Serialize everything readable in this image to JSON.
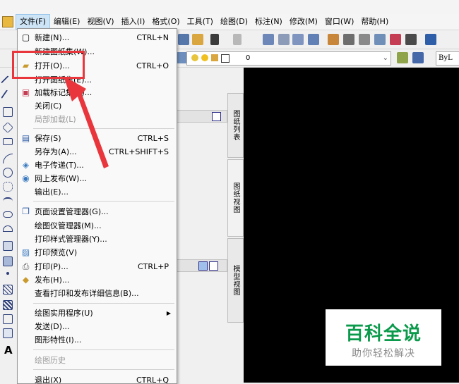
{
  "menubar": {
    "items": [
      "文件(F)",
      "编辑(E)",
      "视图(V)",
      "插入(I)",
      "格式(O)",
      "工具(T)",
      "绘图(D)",
      "标注(N)",
      "修改(M)",
      "窗口(W)",
      "帮助(H)"
    ]
  },
  "toolbar": {
    "layer_value": "0",
    "linetype_value": "ByL"
  },
  "file_menu": {
    "new": {
      "label": "新建(N)...",
      "shortcut": "CTRL+N"
    },
    "new_sheet_set": {
      "label": "新建图纸集(W)..."
    },
    "open": {
      "label": "打开(O)...",
      "shortcut": "CTRL+O"
    },
    "open_sheet_set": {
      "label": "打开图纸集(E)..."
    },
    "load_markup": {
      "label": "加载标记集(K)..."
    },
    "close": {
      "label": "关闭(C)"
    },
    "partial_load": {
      "label": "局部加载(L)"
    },
    "save": {
      "label": "保存(S)",
      "shortcut": "CTRL+S"
    },
    "save_as": {
      "label": "另存为(A)...",
      "shortcut": "CTRL+SHIFT+S"
    },
    "etransmit": {
      "label": "电子传递(T)..."
    },
    "publish_web": {
      "label": "网上发布(W)..."
    },
    "export": {
      "label": "输出(E)..."
    },
    "page_setup": {
      "label": "页面设置管理器(G)..."
    },
    "plotter_manager": {
      "label": "绘图仪管理器(M)..."
    },
    "plot_style_manager": {
      "label": "打印样式管理器(Y)..."
    },
    "plot_preview": {
      "label": "打印预览(V)"
    },
    "plot": {
      "label": "打印(P)...",
      "shortcut": "CTRL+P"
    },
    "publish": {
      "label": "发布(H)..."
    },
    "plot_details": {
      "label": "查看打印和发布详细信息(B)..."
    },
    "drawing_utilities": {
      "label": "绘图实用程序(U)"
    },
    "send": {
      "label": "发送(D)..."
    },
    "drawing_properties": {
      "label": "图形特性(I)..."
    },
    "drawing_history": {
      "label": "绘图历史"
    },
    "exit": {
      "label": "退出(X)",
      "shortcut": "CTRL+Q"
    }
  },
  "palette": {
    "tabs": [
      "图纸列表",
      "图纸视图",
      "模型视图"
    ]
  },
  "watermark": {
    "title": "百科全说",
    "subtitle": "助你轻松解决"
  },
  "colors": {
    "highlight_box": "#e8363c",
    "watermark_green": "#0b9a4b",
    "canvas": "#000000"
  }
}
